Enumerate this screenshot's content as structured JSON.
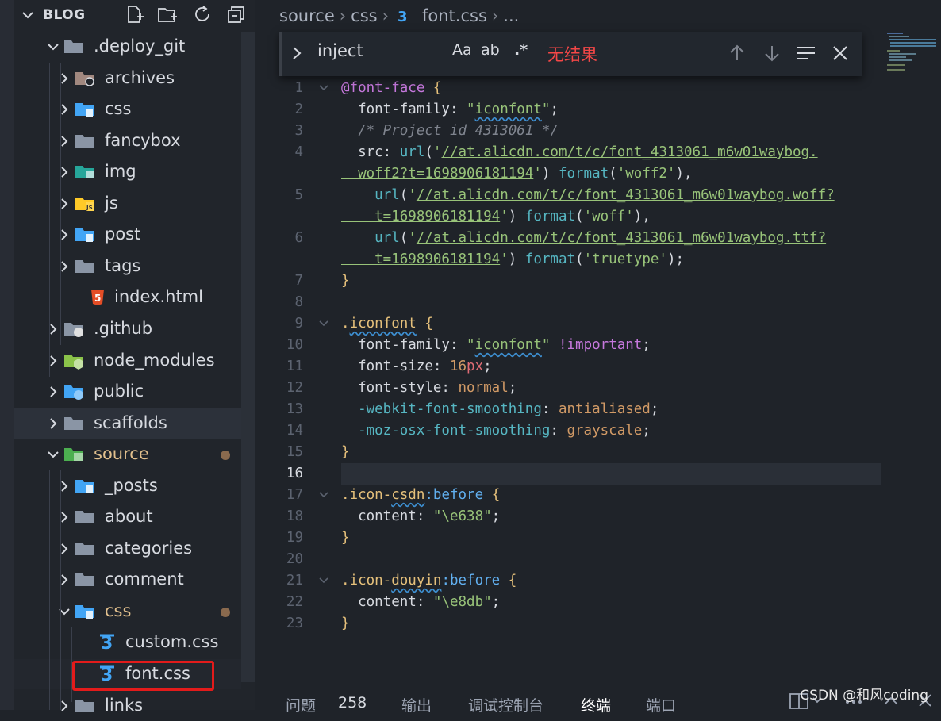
{
  "sidebar": {
    "title": "BLOG",
    "rows": [
      {
        "label": ".deploy_git",
        "indent": 1,
        "expanded": true,
        "icon": "folder-open-icon",
        "mod": false
      },
      {
        "label": "archives",
        "indent": 2,
        "expanded": false,
        "icon": "folder-archives-icon",
        "mod": false
      },
      {
        "label": "css",
        "indent": 2,
        "expanded": false,
        "icon": "folder-css-icon",
        "mod": false
      },
      {
        "label": "fancybox",
        "indent": 2,
        "expanded": false,
        "icon": "folder-icon",
        "mod": false
      },
      {
        "label": "img",
        "indent": 2,
        "expanded": false,
        "icon": "folder-images-icon",
        "mod": false
      },
      {
        "label": "js",
        "indent": 2,
        "expanded": false,
        "icon": "folder-js-icon",
        "mod": false
      },
      {
        "label": "post",
        "indent": 2,
        "expanded": false,
        "icon": "folder-post-icon",
        "mod": false
      },
      {
        "label": "tags",
        "indent": 2,
        "expanded": false,
        "icon": "folder-icon",
        "mod": false
      },
      {
        "label": "index.html",
        "indent": 2,
        "file": true,
        "icon": "html5-icon",
        "mod": false
      },
      {
        "label": ".github",
        "indent": 1,
        "expanded": false,
        "icon": "folder-github-icon",
        "mod": false
      },
      {
        "label": "node_modules",
        "indent": 1,
        "expanded": false,
        "icon": "folder-node-icon",
        "mod": false
      },
      {
        "label": "public",
        "indent": 1,
        "expanded": false,
        "icon": "folder-public-icon",
        "mod": false
      },
      {
        "label": "scaffolds",
        "indent": 1,
        "expanded": false,
        "icon": "folder-icon",
        "mod": false,
        "hl": true
      },
      {
        "label": "source",
        "indent": 1,
        "expanded": true,
        "icon": "folder-source-icon",
        "mod": true
      },
      {
        "label": "_posts",
        "indent": 2,
        "expanded": false,
        "icon": "folder-post-icon",
        "mod": false
      },
      {
        "label": "about",
        "indent": 2,
        "expanded": false,
        "icon": "folder-icon",
        "mod": false
      },
      {
        "label": "categories",
        "indent": 2,
        "expanded": false,
        "icon": "folder-icon",
        "mod": false
      },
      {
        "label": "comment",
        "indent": 2,
        "expanded": false,
        "icon": "folder-icon",
        "mod": false
      },
      {
        "label": "css",
        "indent": 2,
        "expanded": true,
        "icon": "folder-css-open-icon",
        "mod": true
      },
      {
        "label": "custom.css",
        "indent": 3,
        "file": true,
        "icon": "css3-icon",
        "mod": false
      },
      {
        "label": "font.css",
        "indent": 3,
        "file": true,
        "icon": "css3-icon",
        "mod": false,
        "sel": true
      },
      {
        "label": "links",
        "indent": 2,
        "expanded": false,
        "icon": "folder-icon",
        "mod": false
      }
    ]
  },
  "breadcrumb": {
    "parts": [
      "source",
      "css",
      "font.css",
      "..."
    ]
  },
  "find": {
    "query": "inject",
    "opt_case": "Aa",
    "opt_word": "ab",
    "opt_regex": ".*",
    "no_results": "无结果"
  },
  "editor": {
    "current_line": "16",
    "lines": [
      {
        "n": "1",
        "fold": true,
        "tokens": [
          [
            "k-at",
            "@font-face"
          ],
          [
            "k-punc",
            " "
          ],
          [
            "k-brace",
            "{"
          ]
        ]
      },
      {
        "n": "2",
        "tokens": [
          [
            "k-prop",
            "  font-family: "
          ],
          [
            "k-str",
            "\""
          ],
          [
            "k-str squig",
            "iconfont"
          ],
          [
            "k-str",
            "\""
          ],
          [
            "k-punc",
            ";"
          ]
        ]
      },
      {
        "n": "3",
        "tokens": [
          [
            "k-com",
            "  /* Project id 4313061 */"
          ]
        ]
      },
      {
        "n": "4",
        "tokens": [
          [
            "k-prop",
            "  src: "
          ],
          [
            "k-fn",
            "url"
          ],
          [
            "k-punc",
            "("
          ],
          [
            "k-str",
            "'"
          ],
          [
            "k-url",
            "//at.alicdn.com/t/c/font_4313061_m6w01waybog."
          ],
          [
            "k-punc",
            ""
          ]
        ]
      },
      {
        "n": "",
        "tokens": [
          [
            "k-url",
            "  woff2?t=1698906181194"
          ],
          [
            "k-str",
            "'"
          ],
          [
            "k-punc",
            ") "
          ],
          [
            "k-fn",
            "format"
          ],
          [
            "k-punc",
            "("
          ],
          [
            "k-str",
            "'woff2'"
          ],
          [
            "k-punc",
            "),"
          ]
        ]
      },
      {
        "n": "5",
        "tokens": [
          [
            "k-punc",
            "    "
          ],
          [
            "k-fn",
            "url"
          ],
          [
            "k-punc",
            "("
          ],
          [
            "k-str",
            "'"
          ],
          [
            "k-url",
            "//at.alicdn.com/t/c/font_4313061_m6w01waybog.woff?"
          ]
        ]
      },
      {
        "n": "",
        "tokens": [
          [
            "k-url",
            "    t=1698906181194"
          ],
          [
            "k-str",
            "'"
          ],
          [
            "k-punc",
            ") "
          ],
          [
            "k-fn",
            "format"
          ],
          [
            "k-punc",
            "("
          ],
          [
            "k-str",
            "'woff'"
          ],
          [
            "k-punc",
            "),"
          ]
        ]
      },
      {
        "n": "6",
        "tokens": [
          [
            "k-punc",
            "    "
          ],
          [
            "k-fn",
            "url"
          ],
          [
            "k-punc",
            "("
          ],
          [
            "k-str",
            "'"
          ],
          [
            "k-url",
            "//at.alicdn.com/t/c/font_4313061_m6w01waybog.ttf?"
          ]
        ]
      },
      {
        "n": "",
        "tokens": [
          [
            "k-url",
            "    t=1698906181194"
          ],
          [
            "k-str",
            "'"
          ],
          [
            "k-punc",
            ") "
          ],
          [
            "k-fn",
            "format"
          ],
          [
            "k-punc",
            "("
          ],
          [
            "k-str",
            "'truetype'"
          ],
          [
            "k-punc",
            ");"
          ]
        ]
      },
      {
        "n": "7",
        "tokens": [
          [
            "k-brace",
            "}"
          ]
        ]
      },
      {
        "n": "8",
        "tokens": []
      },
      {
        "n": "9",
        "fold": true,
        "tokens": [
          [
            "k-cls",
            "."
          ],
          [
            "k-cls squig",
            "iconfont"
          ],
          [
            "k-punc",
            " "
          ],
          [
            "k-brace",
            "{"
          ]
        ]
      },
      {
        "n": "10",
        "tokens": [
          [
            "k-prop",
            "  font-family: "
          ],
          [
            "k-str",
            "\""
          ],
          [
            "k-str squig",
            "iconfont"
          ],
          [
            "k-str",
            "\""
          ],
          [
            "k-punc",
            " "
          ],
          [
            "k-imp",
            "!important"
          ],
          [
            "k-punc",
            ";"
          ]
        ]
      },
      {
        "n": "11",
        "tokens": [
          [
            "k-prop",
            "  font-size: "
          ],
          [
            "k-num",
            "16"
          ],
          [
            "k-unit",
            "px"
          ],
          [
            "k-punc",
            ";"
          ]
        ]
      },
      {
        "n": "12",
        "tokens": [
          [
            "k-prop",
            "  font-style: "
          ],
          [
            "k-val",
            "normal"
          ],
          [
            "k-punc",
            ";"
          ]
        ]
      },
      {
        "n": "13",
        "tokens": [
          [
            "k-vendor",
            "  -webkit-font-smoothing"
          ],
          [
            "k-punc",
            ": "
          ],
          [
            "k-val",
            "antialiased"
          ],
          [
            "k-punc",
            ";"
          ]
        ]
      },
      {
        "n": "14",
        "tokens": [
          [
            "k-vendor",
            "  -moz-osx-font-smoothing"
          ],
          [
            "k-punc",
            ": "
          ],
          [
            "k-val",
            "grayscale"
          ],
          [
            "k-punc",
            ";"
          ]
        ]
      },
      {
        "n": "15",
        "tokens": [
          [
            "k-brace",
            "}"
          ]
        ]
      },
      {
        "n": "16",
        "tokens": []
      },
      {
        "n": "17",
        "fold": true,
        "tokens": [
          [
            "k-cls",
            ".icon-"
          ],
          [
            "k-cls squig",
            "csdn"
          ],
          [
            "k-pseudo",
            ":before"
          ],
          [
            "k-punc",
            " "
          ],
          [
            "k-brace",
            "{"
          ]
        ]
      },
      {
        "n": "18",
        "tokens": [
          [
            "k-prop",
            "  content: "
          ],
          [
            "k-str",
            "\"\\e638\""
          ],
          [
            "k-punc",
            ";"
          ]
        ]
      },
      {
        "n": "19",
        "tokens": [
          [
            "k-brace",
            "}"
          ]
        ]
      },
      {
        "n": "20",
        "tokens": []
      },
      {
        "n": "21",
        "fold": true,
        "tokens": [
          [
            "k-cls",
            ".icon-"
          ],
          [
            "k-cls squig",
            "douyin"
          ],
          [
            "k-pseudo",
            ":before"
          ],
          [
            "k-punc",
            " "
          ],
          [
            "k-brace",
            "{"
          ]
        ]
      },
      {
        "n": "22",
        "tokens": [
          [
            "k-prop",
            "  content: "
          ],
          [
            "k-str",
            "\"\\e8db\""
          ],
          [
            "k-punc",
            ";"
          ]
        ]
      },
      {
        "n": "23",
        "tokens": [
          [
            "k-brace",
            "}"
          ]
        ]
      }
    ]
  },
  "panel": {
    "tabs": [
      "问题",
      "258",
      "输出",
      "调试控制台",
      "终端",
      "端口"
    ],
    "active_tab": "终端"
  },
  "watermark": "CSDN @和风coding"
}
